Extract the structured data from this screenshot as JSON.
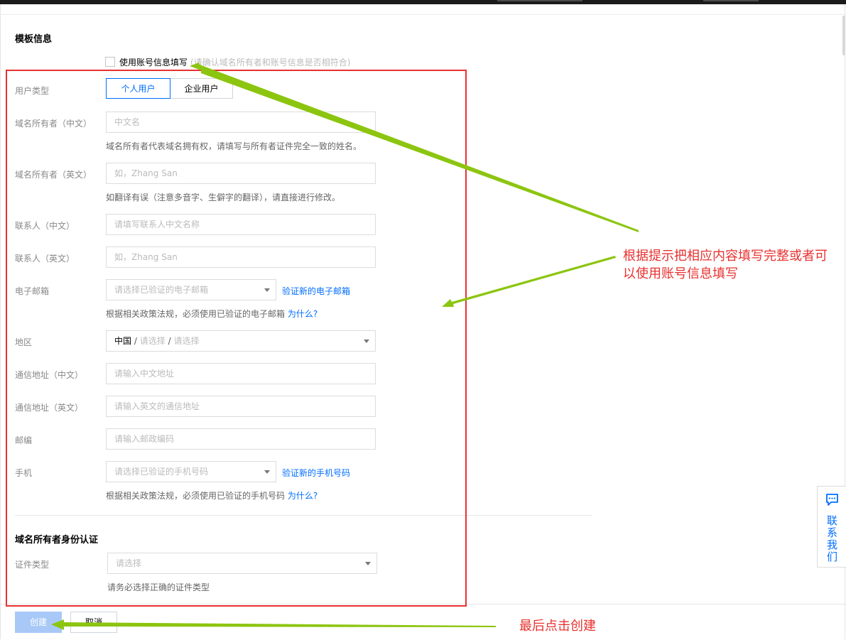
{
  "section_template_title": "模板信息",
  "use_account_info": {
    "label": "使用账号信息填写",
    "hint": "(请确认域名所有者和账号信息是否相符合)"
  },
  "user_type": {
    "label": "用户类型",
    "options": [
      "个人用户",
      "企业用户"
    ],
    "selected": "个人用户"
  },
  "fields": {
    "owner_cn": {
      "label": "域名所有者（中文）",
      "placeholder": "中文名",
      "help": "域名所有者代表域名拥有权，请填写与所有者证件完全一致的姓名。"
    },
    "owner_en": {
      "label": "域名所有者（英文）",
      "placeholder": "如，Zhang San",
      "help": "如翻译有误（注意多音字、生僻字的翻译），请直接进行修改。"
    },
    "contact_cn": {
      "label": "联系人（中文）",
      "placeholder": "请填写联系人中文名称"
    },
    "contact_en": {
      "label": "联系人（英文）",
      "placeholder": "如，Zhang San"
    },
    "email": {
      "label": "电子邮箱",
      "placeholder": "请选择已验证的电子邮箱",
      "side_link": "验证新的电子邮箱",
      "help": "根据相关政策法规，必须使用已验证的电子邮箱",
      "help_link": "为什么?"
    },
    "region": {
      "label": "地区",
      "country": "中国",
      "province": "请选择",
      "city": "请选择",
      "sep": "/"
    },
    "address_cn": {
      "label": "通信地址（中文）",
      "placeholder": "请输入中文地址"
    },
    "address_en": {
      "label": "通信地址（英文）",
      "placeholder": "请输入英文的通信地址"
    },
    "postcode": {
      "label": "邮编",
      "placeholder": "请输入邮政编码"
    },
    "mobile": {
      "label": "手机",
      "placeholder": "请选择已验证的手机号码",
      "side_link": "验证新的手机号码",
      "help": "根据相关政策法规，必须使用已验证的手机号码",
      "help_link": "为什么?"
    }
  },
  "identity_section": {
    "title": "域名所有者身份认证",
    "cert_type": {
      "label": "证件类型",
      "placeholder": "请选择",
      "help": "请务必选择正确的证件类型"
    }
  },
  "buttons": {
    "create": "创建",
    "cancel": "取消"
  },
  "contact_us": "联系我们",
  "annotations": {
    "fill_hint": "根据提示把相应内容填写完整或者可以使用账号信息填写",
    "fill_hint_line1": "根据提示把相应内容填写完整或者可",
    "fill_hint_line2": "以使用账号信息填写",
    "create_hint": "最后点击创建"
  },
  "colors": {
    "accent": "#006eff",
    "annotation": "#e8312f",
    "arrow": "#8cc510",
    "create_disabled": "#a8c9f7"
  },
  "icons": [
    "chat-icon",
    "caret-down-icon"
  ]
}
